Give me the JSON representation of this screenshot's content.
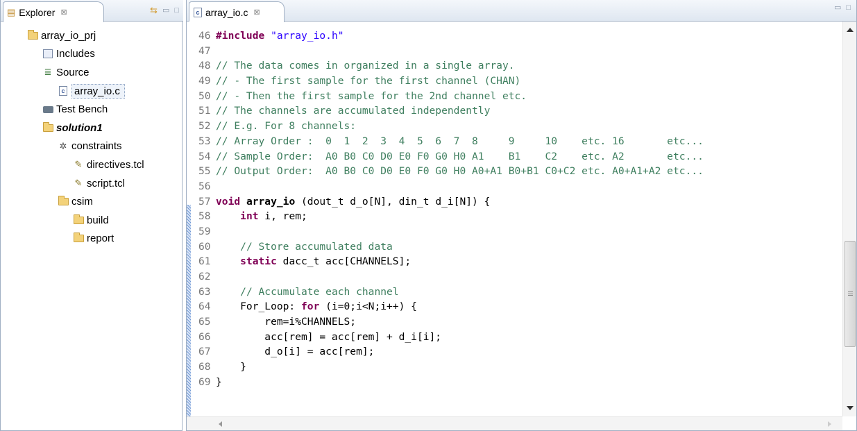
{
  "explorer": {
    "tab_label": "Explorer",
    "tab_close": "⊠",
    "tree": [
      {
        "label": "array_io_prj",
        "indent": 0,
        "icon": "project-icon"
      },
      {
        "label": "Includes",
        "indent": 1,
        "icon": "includes-icon"
      },
      {
        "label": "Source",
        "indent": 1,
        "icon": "source-icon"
      },
      {
        "label": "array_io.c",
        "indent": 2,
        "icon": "c-file-icon",
        "selected": true
      },
      {
        "label": "Test Bench",
        "indent": 1,
        "icon": "testbench-icon"
      },
      {
        "label": "solution1",
        "indent": 1,
        "icon": "solution-folder-icon",
        "bold": true
      },
      {
        "label": "constraints",
        "indent": 2,
        "icon": "gear-icon"
      },
      {
        "label": "directives.tcl",
        "indent": 3,
        "icon": "tcl-file-icon"
      },
      {
        "label": "script.tcl",
        "indent": 3,
        "icon": "tcl-file-icon"
      },
      {
        "label": "csim",
        "indent": 2,
        "icon": "folder-icon"
      },
      {
        "label": "build",
        "indent": 3,
        "icon": "folder-icon"
      },
      {
        "label": "report",
        "indent": 3,
        "icon": "folder-icon"
      }
    ]
  },
  "editor": {
    "tab_label": "array_io.c",
    "tab_close": "⊠",
    "lines": [
      {
        "n": "46",
        "tokens": [
          {
            "t": "#include ",
            "c": "dir"
          },
          {
            "t": "\"array_io.h\"",
            "c": "st"
          }
        ]
      },
      {
        "n": "47",
        "tokens": []
      },
      {
        "n": "48",
        "tokens": [
          {
            "t": "// The data comes in organized in a single array.",
            "c": "cm"
          }
        ]
      },
      {
        "n": "49",
        "tokens": [
          {
            "t": "// - The first sample for the first channel (CHAN)",
            "c": "cm"
          }
        ]
      },
      {
        "n": "50",
        "tokens": [
          {
            "t": "// - Then the first sample for the 2nd channel etc.",
            "c": "cm"
          }
        ]
      },
      {
        "n": "51",
        "tokens": [
          {
            "t": "// The channels are accumulated independently",
            "c": "cm"
          }
        ]
      },
      {
        "n": "52",
        "tokens": [
          {
            "t": "// E.g. For 8 channels:",
            "c": "cm"
          }
        ]
      },
      {
        "n": "53",
        "tokens": [
          {
            "t": "// Array Order :  0  1  2  3  4  5  6  7  8     9     10    etc. 16       etc...",
            "c": "cm"
          }
        ]
      },
      {
        "n": "54",
        "tokens": [
          {
            "t": "// Sample Order:  A0 B0 C0 D0 E0 F0 G0 H0 A1    B1    C2    etc. A2       etc...",
            "c": "cm"
          }
        ]
      },
      {
        "n": "55",
        "tokens": [
          {
            "t": "// Output Order:  A0 B0 C0 D0 E0 F0 G0 H0 A0+A1 B0+B1 C0+C2 etc. A0+A1+A2 etc...",
            "c": "cm"
          }
        ]
      },
      {
        "n": "56",
        "tokens": []
      },
      {
        "n": "57",
        "tokens": [
          {
            "t": "void ",
            "c": "kw"
          },
          {
            "t": "array_io",
            "c": "fn"
          },
          {
            "t": " (dout_t d_o[N], din_t d_i[N]) {",
            "c": ""
          }
        ]
      },
      {
        "n": "58",
        "tokens": [
          {
            "t": "    ",
            "c": ""
          },
          {
            "t": "int",
            "c": "kw"
          },
          {
            "t": " i, rem;",
            "c": ""
          }
        ]
      },
      {
        "n": "59",
        "tokens": []
      },
      {
        "n": "60",
        "tokens": [
          {
            "t": "    ",
            "c": ""
          },
          {
            "t": "// Store accumulated data",
            "c": "cm"
          }
        ]
      },
      {
        "n": "61",
        "tokens": [
          {
            "t": "    ",
            "c": ""
          },
          {
            "t": "static",
            "c": "kw"
          },
          {
            "t": " dacc_t acc[CHANNELS];",
            "c": ""
          }
        ]
      },
      {
        "n": "62",
        "tokens": []
      },
      {
        "n": "63",
        "tokens": [
          {
            "t": "    ",
            "c": ""
          },
          {
            "t": "// Accumulate each channel",
            "c": "cm"
          }
        ]
      },
      {
        "n": "64",
        "tokens": [
          {
            "t": "    For_Loop: ",
            "c": ""
          },
          {
            "t": "for",
            "c": "kw"
          },
          {
            "t": " (i=0;i<N;i++) {",
            "c": ""
          }
        ]
      },
      {
        "n": "65",
        "tokens": [
          {
            "t": "        rem=i%CHANNELS;",
            "c": ""
          }
        ]
      },
      {
        "n": "66",
        "tokens": [
          {
            "t": "        acc[rem] = acc[rem] + d_i[i];",
            "c": ""
          }
        ]
      },
      {
        "n": "67",
        "tokens": [
          {
            "t": "        d_o[i] = acc[rem];",
            "c": ""
          }
        ]
      },
      {
        "n": "68",
        "tokens": [
          {
            "t": "    }",
            "c": ""
          }
        ]
      },
      {
        "n": "69",
        "tokens": [
          {
            "t": "}",
            "c": ""
          }
        ]
      }
    ]
  }
}
